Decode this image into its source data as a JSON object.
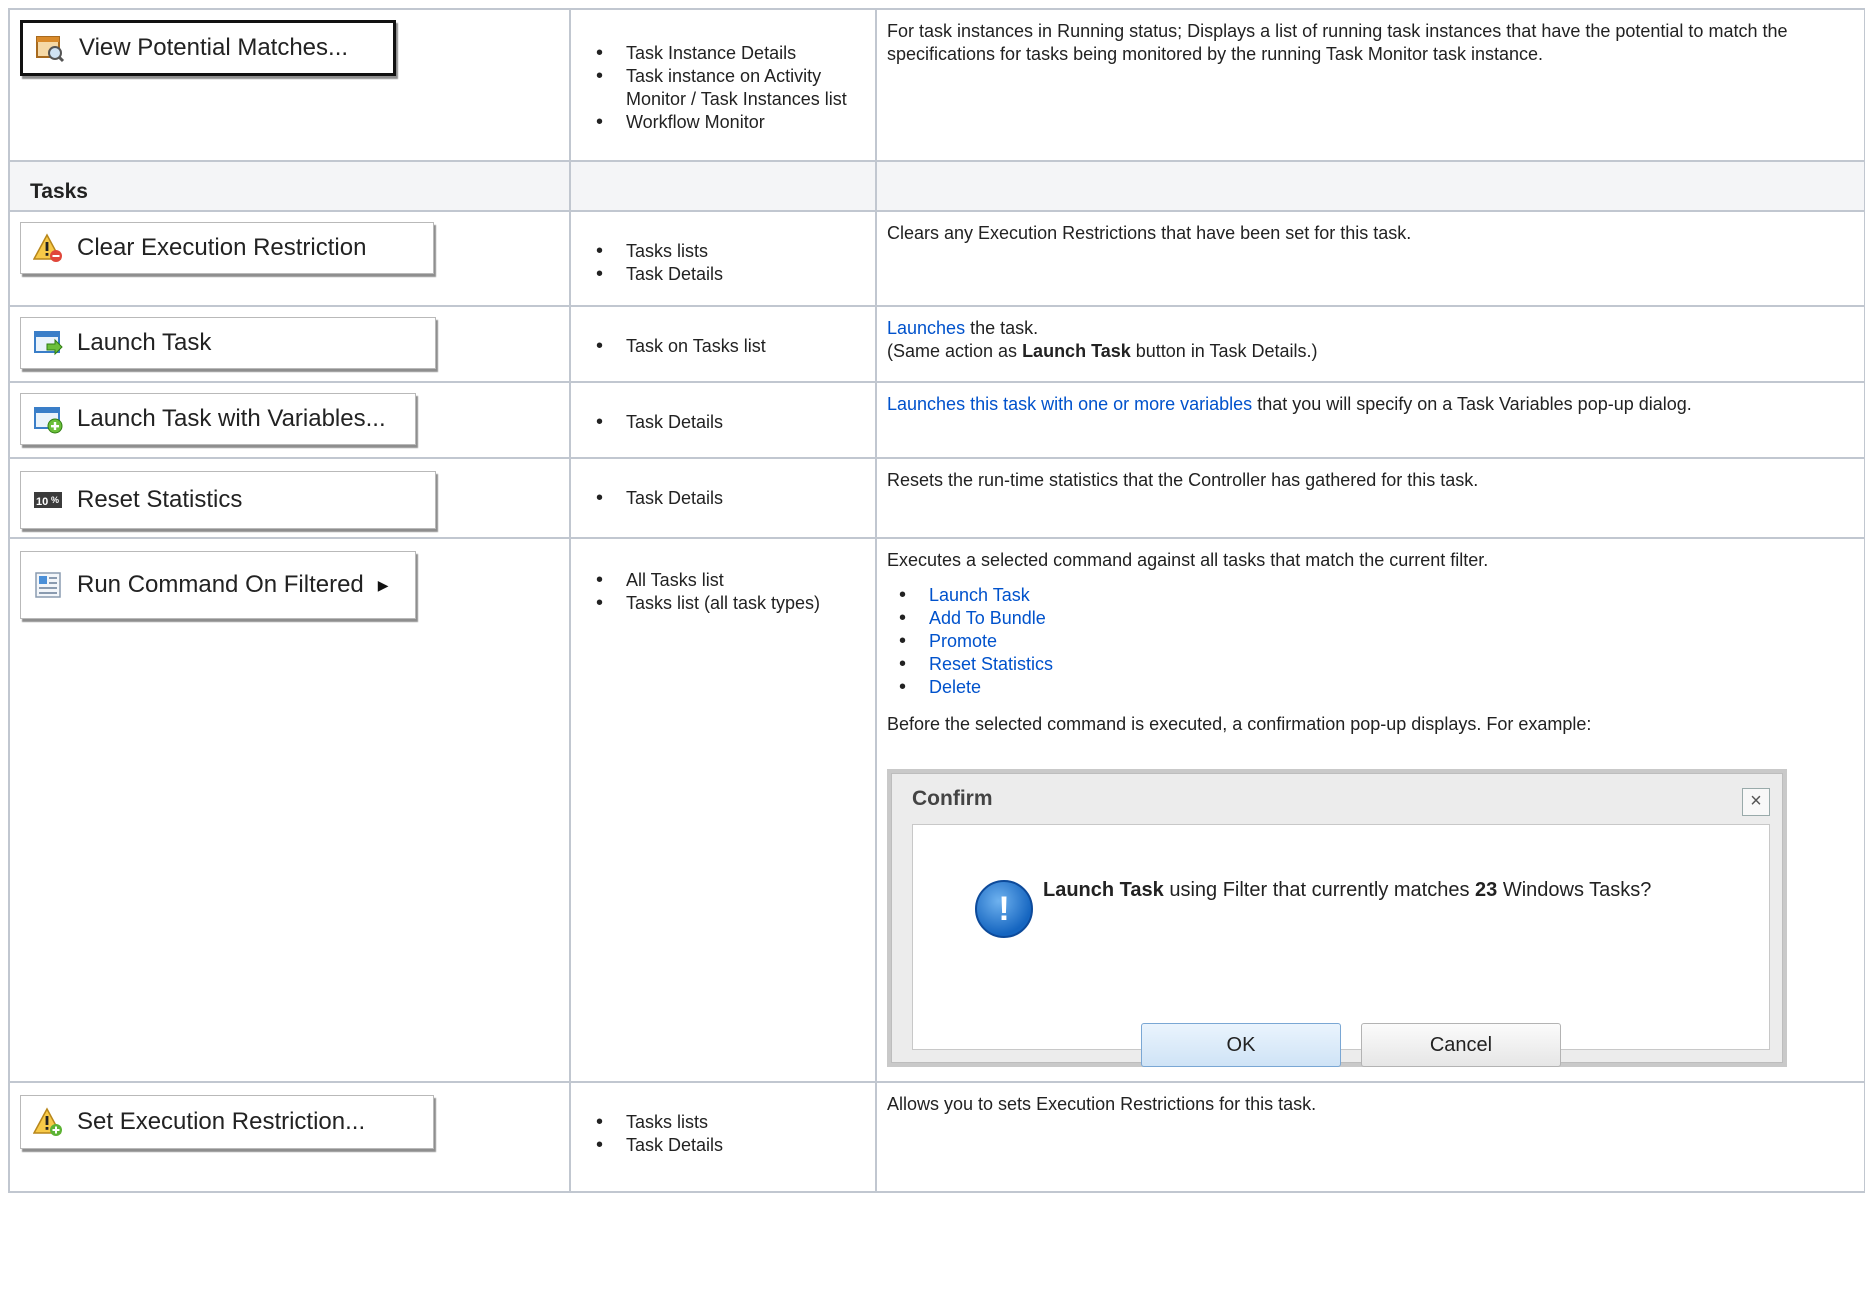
{
  "rows": [
    {
      "button_label": "View Potential Matches...",
      "icon": "view-matches-icon",
      "locations": [
        "Task Instance Details",
        "Task instance on Activity Monitor / Task Instances list",
        "Workflow Monitor"
      ],
      "description": "For task instances in Running status; Displays a list of running task instances that have the potential to match the specifications for tasks being monitored by the running Task Monitor task instance."
    },
    {
      "section": "Tasks"
    },
    {
      "button_label": "Clear Execution Restriction",
      "icon": "warning-restriction-icon",
      "locations": [
        "Tasks lists",
        "Task Details"
      ],
      "description": "Clears any Execution Restrictions that have been set for this task."
    },
    {
      "button_label": "Launch Task",
      "icon": "launch-task-icon",
      "locations": [
        "Task on Tasks list"
      ],
      "desc_link": "Launches",
      "desc_rest": " the task.",
      "desc_line2_pre": "(Same action as ",
      "desc_line2_bold": "Launch Task",
      "desc_line2_post": " button in Task Details.)"
    },
    {
      "button_label": "Launch Task with Variables...",
      "icon": "launch-variables-icon",
      "locations": [
        "Task Details"
      ],
      "desc_link": "Launches this task with one or more variables",
      "desc_rest": " that you will specify on a Task Variables pop-up dialog."
    },
    {
      "button_label": "Reset Statistics",
      "icon": "reset-statistics-icon",
      "locations": [
        "Task Details"
      ],
      "description": "Resets the run-time statistics that the Controller has gathered for this task."
    },
    {
      "button_label": "Run Command On Filtered",
      "icon": "run-command-icon",
      "locations": [
        "All Tasks list",
        "Tasks list (all task types)"
      ],
      "description": "Executes a selected command against all tasks that match the current filter.",
      "commands": [
        "Launch Task",
        "Add To Bundle",
        "Promote",
        "Reset Statistics",
        "Delete"
      ],
      "note": "Before the selected command is executed, a confirmation pop-up displays. For example:",
      "dialog": {
        "title": "Confirm",
        "msg_bold1": "Launch Task",
        "msg_mid": " using Filter that currently matches ",
        "msg_bold2": "23",
        "msg_end": " Windows Tasks?",
        "ok": "OK",
        "cancel": "Cancel",
        "info_glyph": "!",
        "close_glyph": "×"
      }
    },
    {
      "button_label": "Set Execution Restriction...",
      "icon": "set-restriction-icon",
      "locations": [
        "Tasks lists",
        "Task Details"
      ],
      "description": "Allows you to sets Execution Restrictions for this task."
    }
  ],
  "colors": {
    "link": "#0052cc",
    "border": "#c1c7d0",
    "section_bg": "#f4f5f7"
  }
}
